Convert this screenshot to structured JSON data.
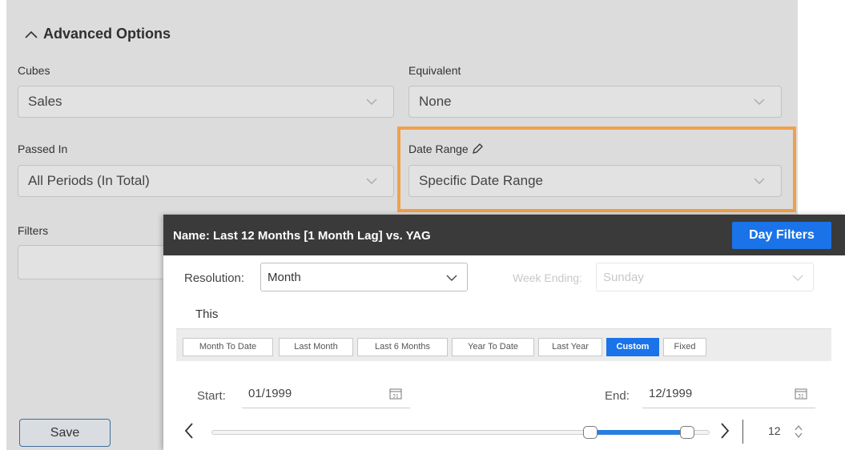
{
  "advanced": {
    "title": "Advanced Options",
    "cubes_label": "Cubes",
    "cubes_value": "Sales",
    "equivalent_label": "Equivalent",
    "equivalent_value": "None",
    "passed_in_label": "Passed In",
    "passed_in_value": "All Periods (In Total)",
    "date_range_label": "Date Range",
    "date_range_value": "Specific Date Range",
    "filters_label": "Filters",
    "save_label": "Save"
  },
  "popup": {
    "title": "Name: Last 12 Months [1 Month Lag] vs. YAG",
    "day_filters_label": "Day Filters",
    "resolution_label": "Resolution:",
    "resolution_value": "Month",
    "week_ending_label": "Week Ending:",
    "week_ending_value": "Sunday",
    "this_label": "This",
    "presets": [
      {
        "label": "Month To Date",
        "active": false
      },
      {
        "label": "Last Month",
        "active": false
      },
      {
        "label": "Last 6 Months",
        "active": false
      },
      {
        "label": "Year To Date",
        "active": false
      },
      {
        "label": "Last Year",
        "active": false
      },
      {
        "label": "Custom",
        "active": true
      },
      {
        "label": "Fixed",
        "active": false
      }
    ],
    "start_label": "Start:",
    "start_value": "01/1999",
    "end_label": "End:",
    "end_value": "12/1999",
    "range_count": "12",
    "slider": {
      "start_fraction": 0.76,
      "end_fraction": 0.955
    }
  },
  "colors": {
    "accent": "#1a73e8",
    "highlight": "#f0a04b",
    "header_bg": "#3a3a3a"
  },
  "icons": {
    "collapse": "chevron-up-icon",
    "dropdown": "chevron-down-icon",
    "edit": "pencil-icon",
    "calendar": "calendar-icon",
    "prev": "chevron-left-icon",
    "next": "chevron-right-icon",
    "spin": "spinner-arrows-icon"
  }
}
